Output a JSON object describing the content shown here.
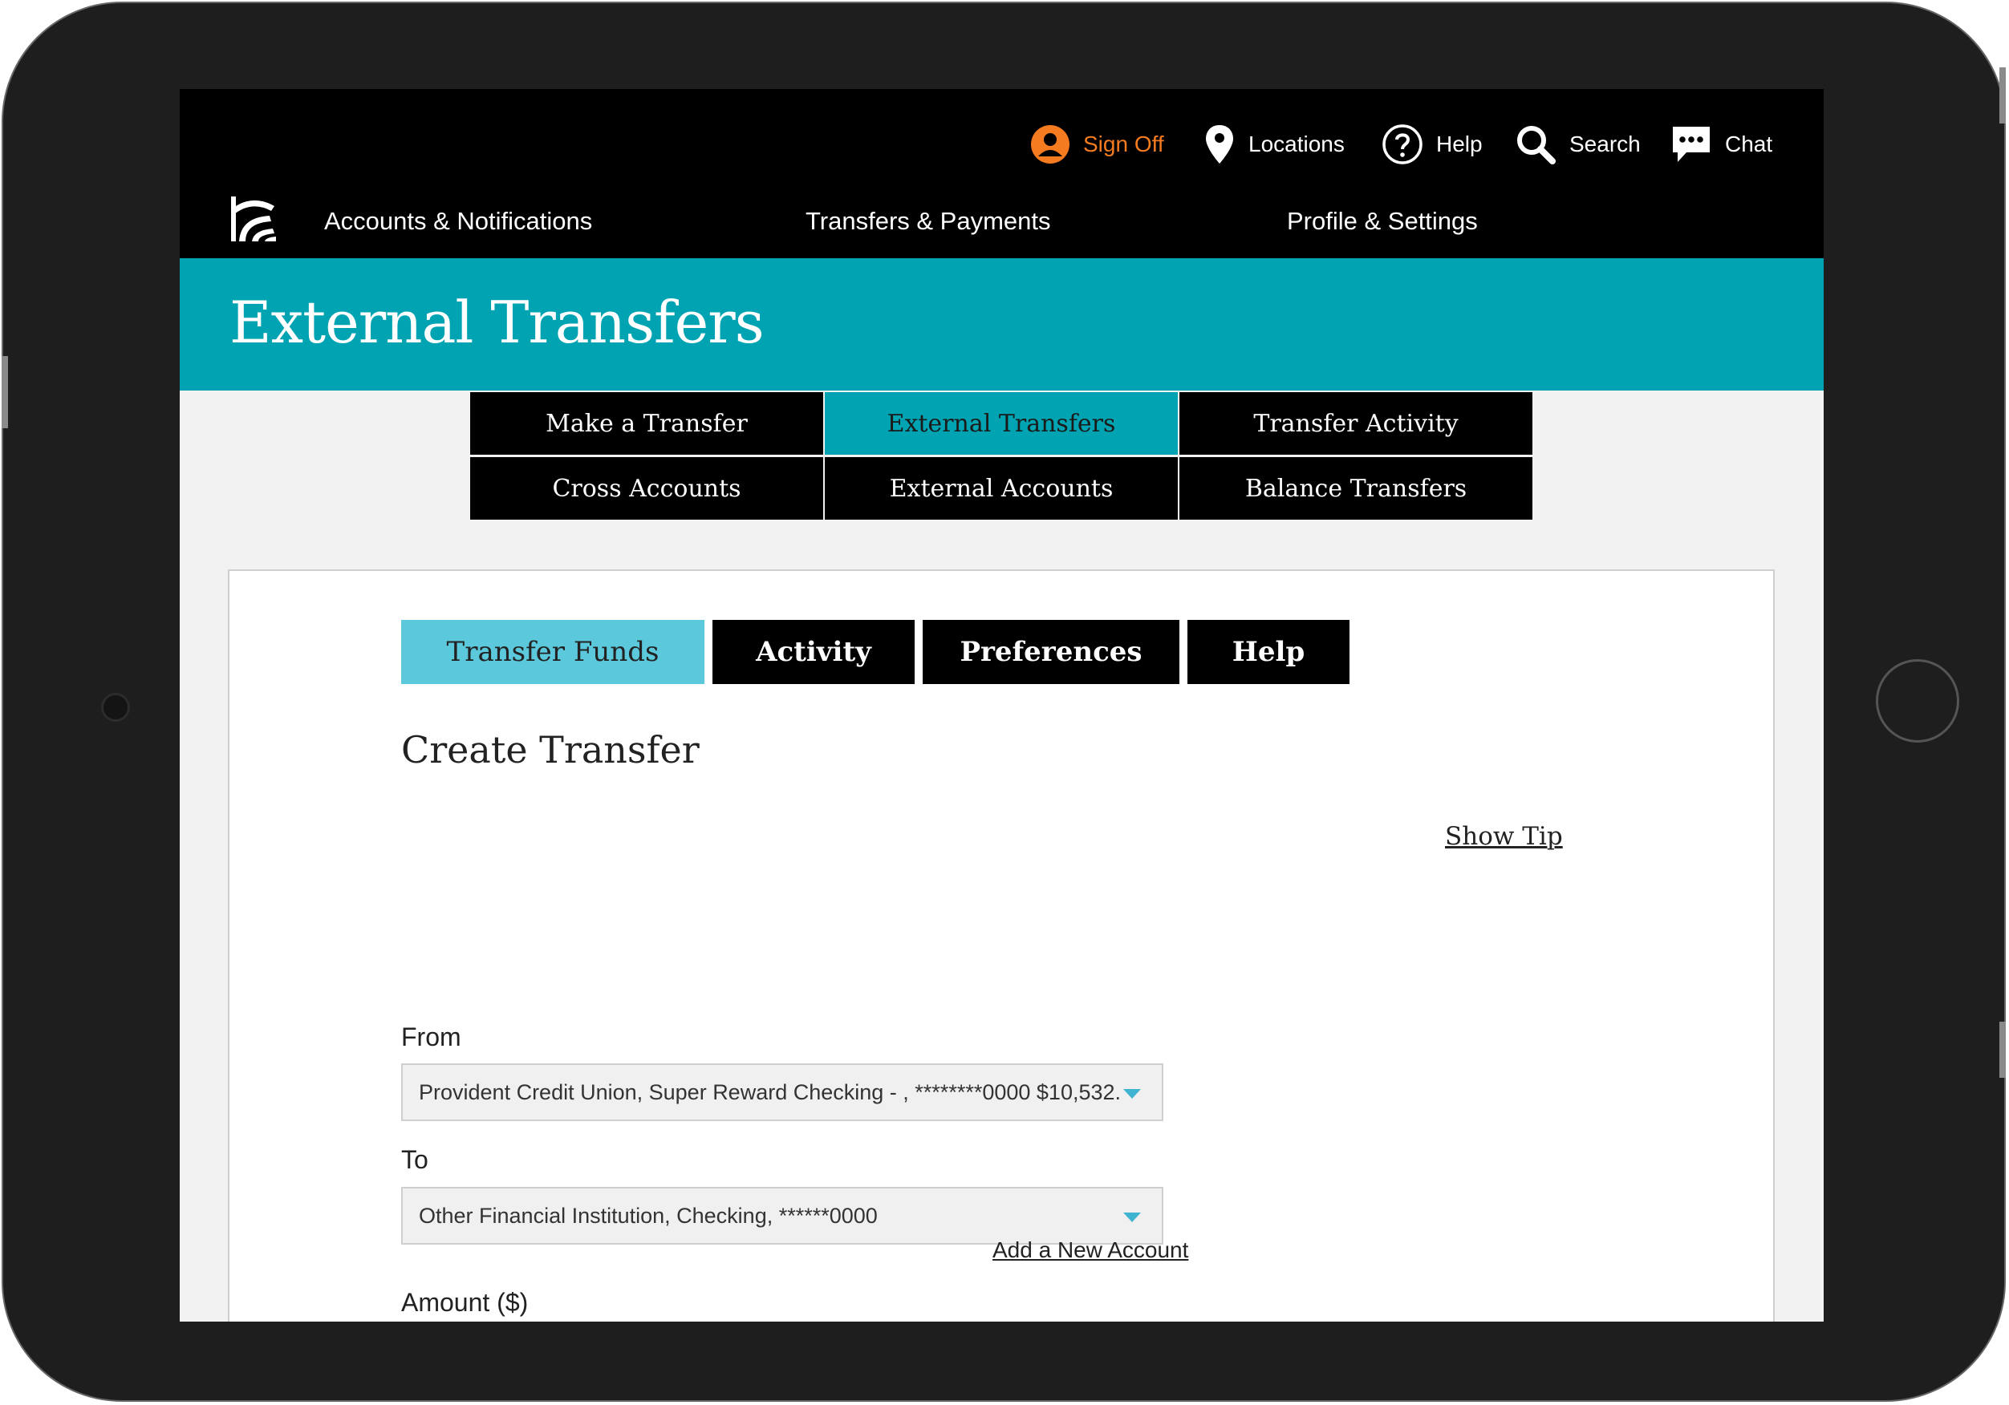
{
  "header": {
    "utility": [
      {
        "label": "Sign Off",
        "icon": "user-icon",
        "color": "#f47b20"
      },
      {
        "label": "Locations",
        "icon": "map-pin-icon"
      },
      {
        "label": "Help",
        "icon": "question-icon"
      },
      {
        "label": "Search",
        "icon": "search-icon"
      },
      {
        "label": "Chat",
        "icon": "chat-icon"
      }
    ],
    "main_nav": [
      "Accounts & Notifications",
      "Transfers & Payments",
      "Profile & Settings"
    ]
  },
  "page": {
    "title": "External Transfers",
    "accent_color": "#00a3b1"
  },
  "subnav": {
    "row1": [
      "Make a Transfer",
      "External Transfers",
      "Transfer Activity"
    ],
    "row2": [
      "Cross Accounts",
      "External Accounts",
      "Balance Transfers"
    ],
    "active": "External Transfers"
  },
  "tabs": {
    "items": [
      "Transfer Funds",
      "Activity",
      "Preferences",
      "Help"
    ],
    "active": "Transfer Funds"
  },
  "form": {
    "heading": "Create Transfer",
    "show_tip": "Show Tip",
    "from_label": "From",
    "from_value": "Provident Credit Union, Super Reward Checking - , ********0000 $10,532.",
    "to_label": "To",
    "to_value": "Other Financial Institution, Checking, ******0000",
    "add_account": "Add a New Account",
    "amount_label": "Amount ($)"
  }
}
